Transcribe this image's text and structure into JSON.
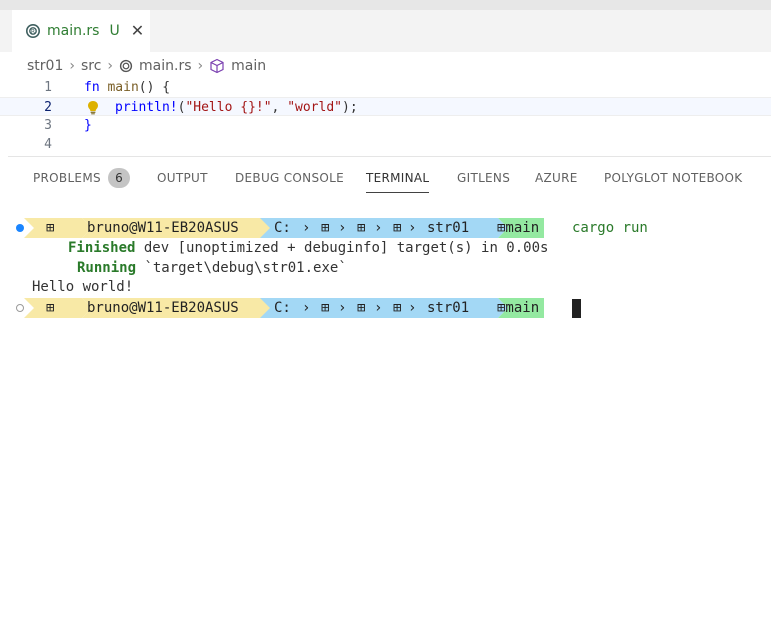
{
  "tab": {
    "filename": "main.rs",
    "status": "U",
    "close_glyph": "✕",
    "icon": "rust-icon"
  },
  "breadcrumb": {
    "items": [
      "str01",
      "src",
      "main.rs",
      "main"
    ],
    "separator": "›"
  },
  "editor": {
    "lines": [
      {
        "number": "1"
      },
      {
        "number": "2"
      },
      {
        "number": "3"
      },
      {
        "number": "4"
      }
    ],
    "code": {
      "l1_kw": "fn",
      "l1_name": "main",
      "l1_rest": "() {",
      "l2_macro": "println!",
      "l2_open": "(",
      "l2_str1": "\"Hello {}!\"",
      "l2_comma": ", ",
      "l2_str2": "\"world\"",
      "l2_close": ");",
      "l3": "}"
    }
  },
  "panel": {
    "tabs": [
      {
        "label": "PROBLEMS"
      },
      {
        "label": "OUTPUT"
      },
      {
        "label": "DEBUG CONSOLE"
      },
      {
        "label": "TERMINAL"
      },
      {
        "label": "GITLENS"
      },
      {
        "label": "AZURE"
      },
      {
        "label": "POLYGLOT NOTEBOOK"
      }
    ],
    "problems_count": "6",
    "active_tab": "TERMINAL"
  },
  "terminal": {
    "prompt1": {
      "os_glyph": "⊞",
      "user": "bruno@W11-EB20ASUS",
      "drive": "C:",
      "dir1": "⊞",
      "dir2": "⊞",
      "folder": "str01",
      "branch": "⊞main",
      "command": "cargo run"
    },
    "finished_label": "Finished",
    "finished_text": "dev [unoptimized + debuginfo] target(s) in 0.00s",
    "running_label": "Running",
    "running_text": "`target\\debug\\str01.exe`",
    "output": "Hello world!",
    "prompt2": {
      "os_glyph": "⊞",
      "user": "bruno@W11-EB20ASUS",
      "drive": "C:",
      "dir1": "⊞",
      "dir2": "⊞",
      "folder": "str01",
      "branch": "⊞main"
    }
  },
  "colors": {
    "segment_yellow": "#f8e9a6",
    "segment_blue": "#a3d8f5",
    "segment_green": "#94e9a1",
    "accent_green": "#2f7d32"
  }
}
